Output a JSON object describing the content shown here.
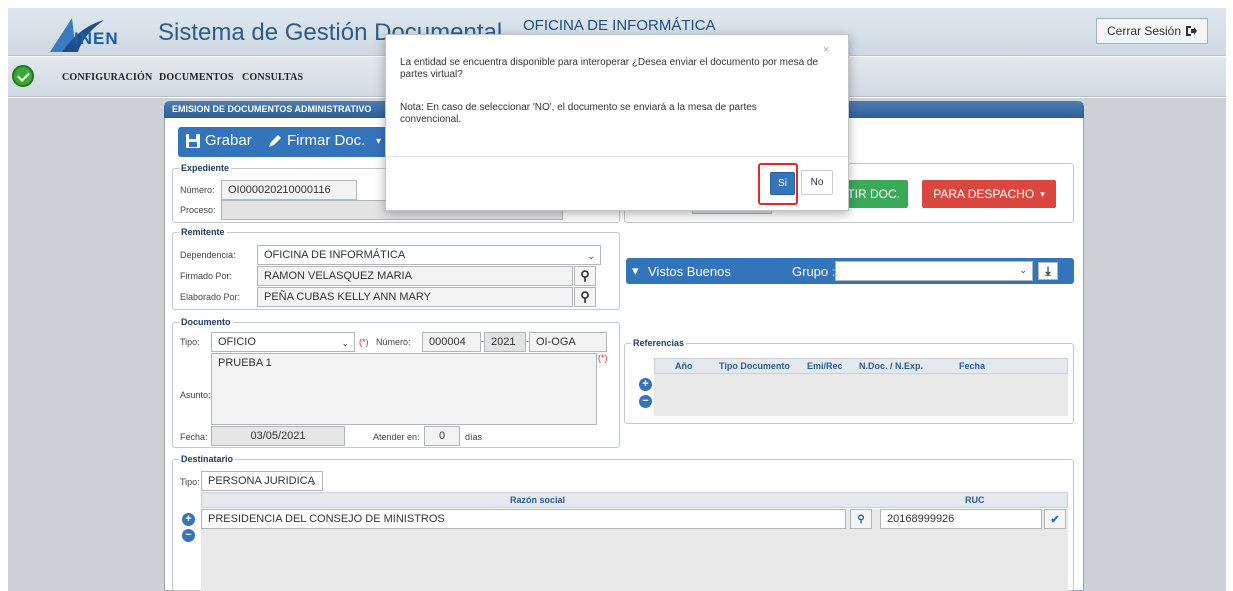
{
  "header": {
    "logo_text": "INEN",
    "app_title": "Sistema de Gestión Documental",
    "office": "OFICINA DE INFORMÁTICA",
    "logout_label": "Cerrar Sesión"
  },
  "menu": {
    "items": [
      "CONFIGURACIÓN",
      "DOCUMENTOS",
      "CONSULTAS"
    ]
  },
  "panel": {
    "title": "EMISION DE DOCUMENTOS ADMINISTRATIVO",
    "toolbar": {
      "save_label": "Grabar",
      "sign_label": "Firmar Doc."
    }
  },
  "expediente": {
    "legend": "Expediente",
    "numero_label": "Número:",
    "numero_value": "OI000020210000116",
    "proceso_label": "Proceso:"
  },
  "actions": {
    "emit_label": "TIR DOC.",
    "dispatch_label": "PARA DESPACHO"
  },
  "remitente": {
    "legend": "Remitente",
    "dependencia_label": "Dependencia:",
    "dependencia_value": "OFICINA DE INFORMÁTICA",
    "firmado_label": "Firmado Por:",
    "firmado_value": "RAMON VELASQUEZ MARIA",
    "elaborado_label": "Elaborado Por:",
    "elaborado_value": "PEÑA CUBAS KELLY ANN MARY"
  },
  "vistos": {
    "label": "Vistos Buenos",
    "grupo_label": "Grupo :"
  },
  "documento": {
    "legend": "Documento",
    "tipo_label": "Tipo:",
    "tipo_value": "OFICIO",
    "required_mark": "(*)",
    "numero_label": "Número:",
    "numero_value": "000004",
    "anio_value": "2021",
    "sigla_value": "OI-OGA",
    "asunto_label": "Asunto:",
    "asunto_value": "PRUEBA 1",
    "fecha_label": "Fecha:",
    "fecha_value": "03/05/2021",
    "atender_label": "Atender en:",
    "atender_value": "0",
    "dias_label": "días"
  },
  "referencias": {
    "legend": "Referencias",
    "columns": [
      "Año",
      "Tipo Documento",
      "Emi/Rec",
      "N.Doc. / N.Exp.",
      "Fecha"
    ]
  },
  "destinatario": {
    "legend": "Destinatario",
    "tipo_label": "Tipo:",
    "tipo_value": "PERSONA JURIDICA",
    "col_razon": "Razón social",
    "col_ruc": "RUC",
    "row_razon": "PRESIDENCIA DEL CONSEJO DE MINISTROS",
    "row_ruc": "20168999926"
  },
  "modal": {
    "close": "×",
    "message": "La entidad se encuentra disponible para interoperar ¿Desea enviar el documento por mesa de partes virtual?",
    "note": "Nota: En caso de seleccionar 'NO', el documento se enviará a la mesa de partes convencional.",
    "yes_label": "Si",
    "no_label": "No"
  }
}
